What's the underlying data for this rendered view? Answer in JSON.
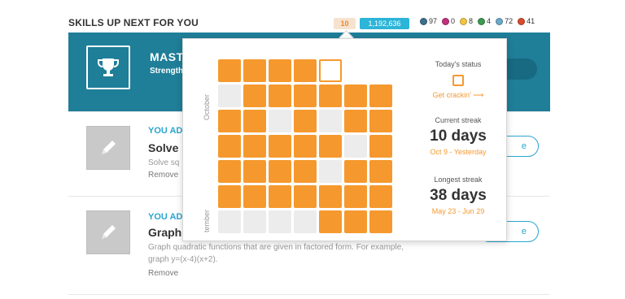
{
  "header": {
    "title": "SKILLS UP NEXT FOR YOU",
    "streak_badge": "10",
    "points_badge": "1,192,636",
    "badge_counts": [
      {
        "name": "sun-badge-icon",
        "color": "#3b6f8c",
        "count": "97"
      },
      {
        "name": "moon-badge-icon",
        "color": "#c2307c",
        "count": "0"
      },
      {
        "name": "earth-badge-icon",
        "color": "#f4c542",
        "count": "8"
      },
      {
        "name": "sun-badge-icon-2",
        "color": "#3a9a4f",
        "count": "4"
      },
      {
        "name": "black-hole-badge-icon",
        "color": "#6aa9c9",
        "count": "72"
      },
      {
        "name": "challenge-badge-icon",
        "color": "#d94b2b",
        "count": "41"
      }
    ]
  },
  "mastery": {
    "title": "MAST",
    "subtitle": "Strength"
  },
  "skills": [
    {
      "tag": "YOU AD",
      "title": "Solve s",
      "desc": "Solve sq",
      "remove": "Remove",
      "button": "e"
    },
    {
      "tag": "YOU AD",
      "title": "Graph",
      "desc": "Graph quadratic functions that are given in factored form. For example, graph y=(x-4)(x+2).",
      "remove": "Remove",
      "button": "e"
    }
  ],
  "popover": {
    "month_top": "October",
    "month_bottom": "tember",
    "grid": [
      [
        "on",
        "on",
        "on",
        "on",
        "today",
        "blank",
        "blank"
      ],
      [
        "off",
        "on",
        "on",
        "on",
        "on",
        "on",
        "on"
      ],
      [
        "on",
        "on",
        "off",
        "on",
        "off",
        "on",
        "on"
      ],
      [
        "on",
        "on",
        "on",
        "on",
        "on",
        "off",
        "on"
      ],
      [
        "on",
        "on",
        "on",
        "on",
        "off",
        "on",
        "on"
      ],
      [
        "on",
        "on",
        "on",
        "on",
        "on",
        "on",
        "on"
      ],
      [
        "off",
        "off",
        "off",
        "off",
        "on",
        "on",
        "on"
      ]
    ],
    "today_label": "Today's status",
    "today_cta": "Get crackin' ⟶",
    "current_label": "Current streak",
    "current_value": "10 days",
    "current_range": "Oct 9 - Yesterday",
    "longest_label": "Longest streak",
    "longest_value": "38 days",
    "longest_range": "May 23 - Jun 29"
  },
  "colors": {
    "accent_orange": "#f5992e",
    "teal": "#1f7e98",
    "blue": "#2aa5d0"
  }
}
